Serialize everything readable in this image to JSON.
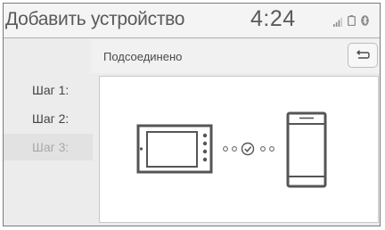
{
  "header": {
    "title": "Добавить устройство",
    "clock": "4:24",
    "status_icons": [
      "signal-icon",
      "battery-icon",
      "bluetooth-icon"
    ]
  },
  "subheader": {
    "title": "Подсоединено",
    "back_icon": "back-arrow-icon"
  },
  "steps": [
    {
      "label": "Шаг 1:",
      "state": "done"
    },
    {
      "label": "Шаг 2:",
      "state": "done"
    },
    {
      "label": "Шаг 3:",
      "state": "current"
    }
  ],
  "diagram": {
    "icons": [
      "head-unit-icon",
      "connected-check-icon",
      "smartphone-icon"
    ]
  }
}
